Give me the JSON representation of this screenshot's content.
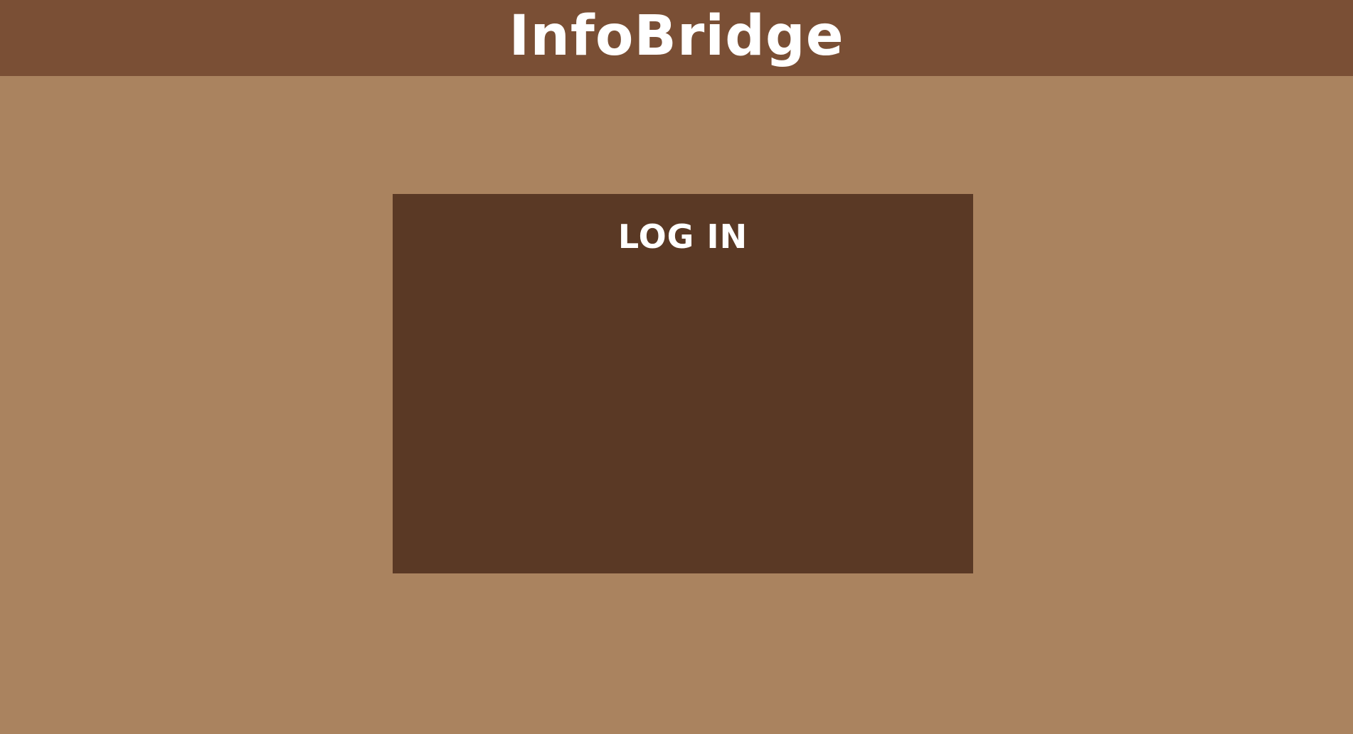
{
  "header": {
    "brand": "InfoBridge"
  },
  "login": {
    "title": "LOG IN"
  },
  "colors": {
    "page_background": "#AA835F",
    "header_background": "#7A4F35",
    "panel_background": "#5A3925",
    "text": "#FFFFFF"
  }
}
